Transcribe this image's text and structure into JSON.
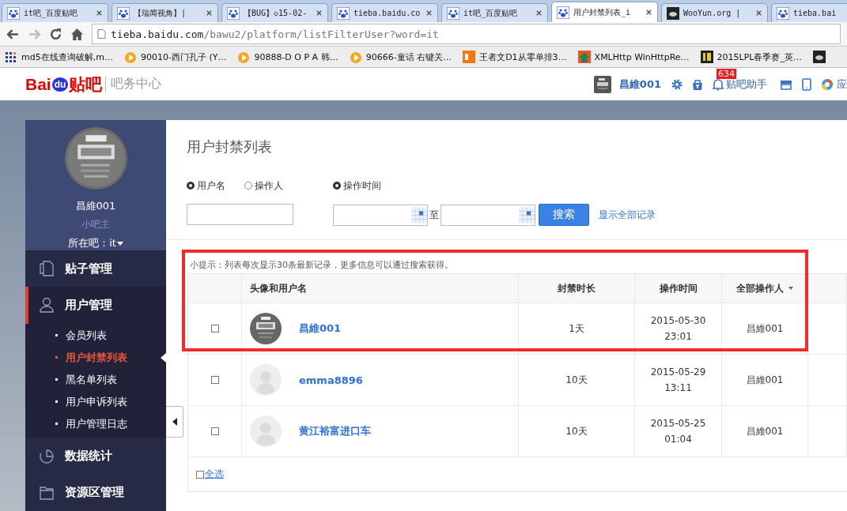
{
  "browser": {
    "tabs": [
      {
        "title": "it吧_百度贴吧",
        "selected": false,
        "kind": "paw"
      },
      {
        "title": "【瑞闻视角】|",
        "selected": false,
        "kind": "paw"
      },
      {
        "title": "【BUG】◇15-02-",
        "selected": false,
        "kind": "paw"
      },
      {
        "title": "tieba.baidu.co",
        "selected": false,
        "kind": "paw"
      },
      {
        "title": "it吧_百度贴吧",
        "selected": false,
        "kind": "paw"
      },
      {
        "title": "用户封禁列表_i",
        "selected": true,
        "kind": "paw"
      },
      {
        "title": "WooYun.org |",
        "selected": false,
        "kind": "cloud"
      },
      {
        "title": "tieba.bai",
        "selected": false,
        "kind": "paw"
      }
    ],
    "address": {
      "host": "tieba.baidu.com",
      "path": "/bawu2/platform/listFilterUser?word=it"
    },
    "bookmarks": [
      {
        "title": "md5在线查询破解,m…",
        "kind": "grid"
      },
      {
        "title": "90010-西门孔子 (Y…",
        "kind": "play"
      },
      {
        "title": "90888-D O P A 韩…",
        "kind": "play"
      },
      {
        "title": "90666-童话 右键关…",
        "kind": "play"
      },
      {
        "title": "王者文D1从零单排3…",
        "kind": "dy"
      },
      {
        "title": "XMLHttp WinHttpRe…",
        "kind": "house"
      },
      {
        "title": "2015LPL春季赛_英…",
        "kind": "num"
      }
    ]
  },
  "header": {
    "logo": {
      "left": "Bai",
      "middle": "du",
      "right": "贴吧"
    },
    "subtitle": "吧务中心",
    "user": "昌維001",
    "badge": "634",
    "helper": "贴吧助手",
    "apps": "应"
  },
  "sidebar": {
    "user": "昌維001",
    "role": "小吧主",
    "forum_label": "所在吧：",
    "forum": "it",
    "menu": [
      {
        "label": "贴子管理",
        "kind": "document",
        "expanded": false,
        "selected": false
      },
      {
        "label": "用户管理",
        "kind": "person",
        "expanded": true,
        "selected": true,
        "children": [
          {
            "label": "会员列表",
            "selected": false
          },
          {
            "label": "用户封禁列表",
            "selected": true
          },
          {
            "label": "黑名单列表",
            "selected": false
          },
          {
            "label": "用户申诉列表",
            "selected": false
          },
          {
            "label": "用户管理日志",
            "selected": false
          }
        ]
      },
      {
        "label": "数据统计",
        "kind": "clock",
        "expanded": false,
        "selected": false
      },
      {
        "label": "资源区管理",
        "kind": "folder",
        "expanded": false,
        "selected": false
      }
    ]
  },
  "content": {
    "title": "用户封禁列表",
    "search_by": [
      {
        "label": "用户名",
        "selected": true
      },
      {
        "label": "操作人",
        "selected": false
      }
    ],
    "time_filter": {
      "label": "操作时间",
      "selected": true
    },
    "range_separator": "至",
    "search_button": "搜索",
    "show_all": "显示全部记录",
    "tip": "小提示：列表每次显示30条最新记录，更多信息可以通过搜索获得。",
    "table": {
      "columns": [
        "头像和用户名",
        "封禁时长",
        "操作时间",
        "全部操作人"
      ],
      "rows": [
        {
          "checked": false,
          "kind": "picture",
          "name": "昌維001",
          "duration": "1天",
          "date": "2015-05-30",
          "time": "23:01",
          "operator": "昌維001",
          "highlighted": true
        },
        {
          "checked": false,
          "kind": "default",
          "name": "emma8896",
          "duration": "10天",
          "date": "2015-05-29",
          "time": "13:11",
          "operator": "昌維001",
          "highlighted": false
        },
        {
          "checked": false,
          "kind": "default",
          "name": "黄江裕富进口车",
          "duration": "10天",
          "date": "2015-05-25",
          "time": "01:04",
          "operator": "昌維001",
          "highlighted": false
        }
      ]
    },
    "select_all": {
      "label": "全选",
      "checked": false
    }
  }
}
